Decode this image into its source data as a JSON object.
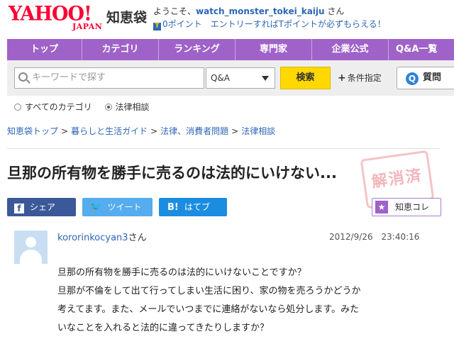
{
  "header": {
    "logo_yahoo": "YAHOO!",
    "logo_japan": "JAPAN",
    "logo_chie": "知恵袋",
    "welcome_prefix": "ようこそ、",
    "username": "watch_monster_tokei_kaiju",
    "welcome_suffix": " さん",
    "points_icon": "T",
    "points": "0ポイント",
    "points_promo": "　エントリーすればTポイントが必ずもらえる！"
  },
  "nav": {
    "items": [
      "トップ",
      "カテゴリ",
      "ランキング",
      "専門家",
      "企業公式",
      "Q&A一覧"
    ]
  },
  "search": {
    "placeholder": "キーワードで探す",
    "select_value": "Q&A",
    "button": "検索",
    "condition": "条件指定",
    "ask_button": "質問"
  },
  "scope": {
    "options": [
      "すべてのカテゴリ",
      "法律相談"
    ],
    "selected": "法律相談"
  },
  "breadcrumb": [
    "知恵袋トップ",
    "暮らしと生活ガイド",
    "法律、消費者問題",
    "法律相談"
  ],
  "question": {
    "title": "旦那の所有物を勝手に売るのは法的にいけない...",
    "stamp_text": "解消済",
    "share": {
      "facebook": "シェア",
      "twitter": "ツイート",
      "hatena_icon": "B!",
      "hatena": "はてブ"
    },
    "chiekore": "知恵コレ",
    "author": "kororinkocyan3",
    "author_suffix": "さん",
    "date": "2012/9/26　23:40:16",
    "body_lines": [
      "旦那の所有物を勝手に売るのは法的にいけないことですか？",
      "旦那が不倫をして出て行ってしまい生活に困り、家の物を売ろうかどうか",
      "考えてます。また、メールでいつまでに連絡がないなら処分します。みた",
      "いなことを入れると法的に違ってきたりしますか？"
    ]
  },
  "colors": {
    "brand_red": "#ff0033",
    "nav_purple": "#9f62c8",
    "search_yellow": "#ffd800",
    "link_blue": "#2e66b5",
    "facebook": "#3b5998",
    "twitter": "#55acee",
    "hatena": "#1b8de1"
  }
}
